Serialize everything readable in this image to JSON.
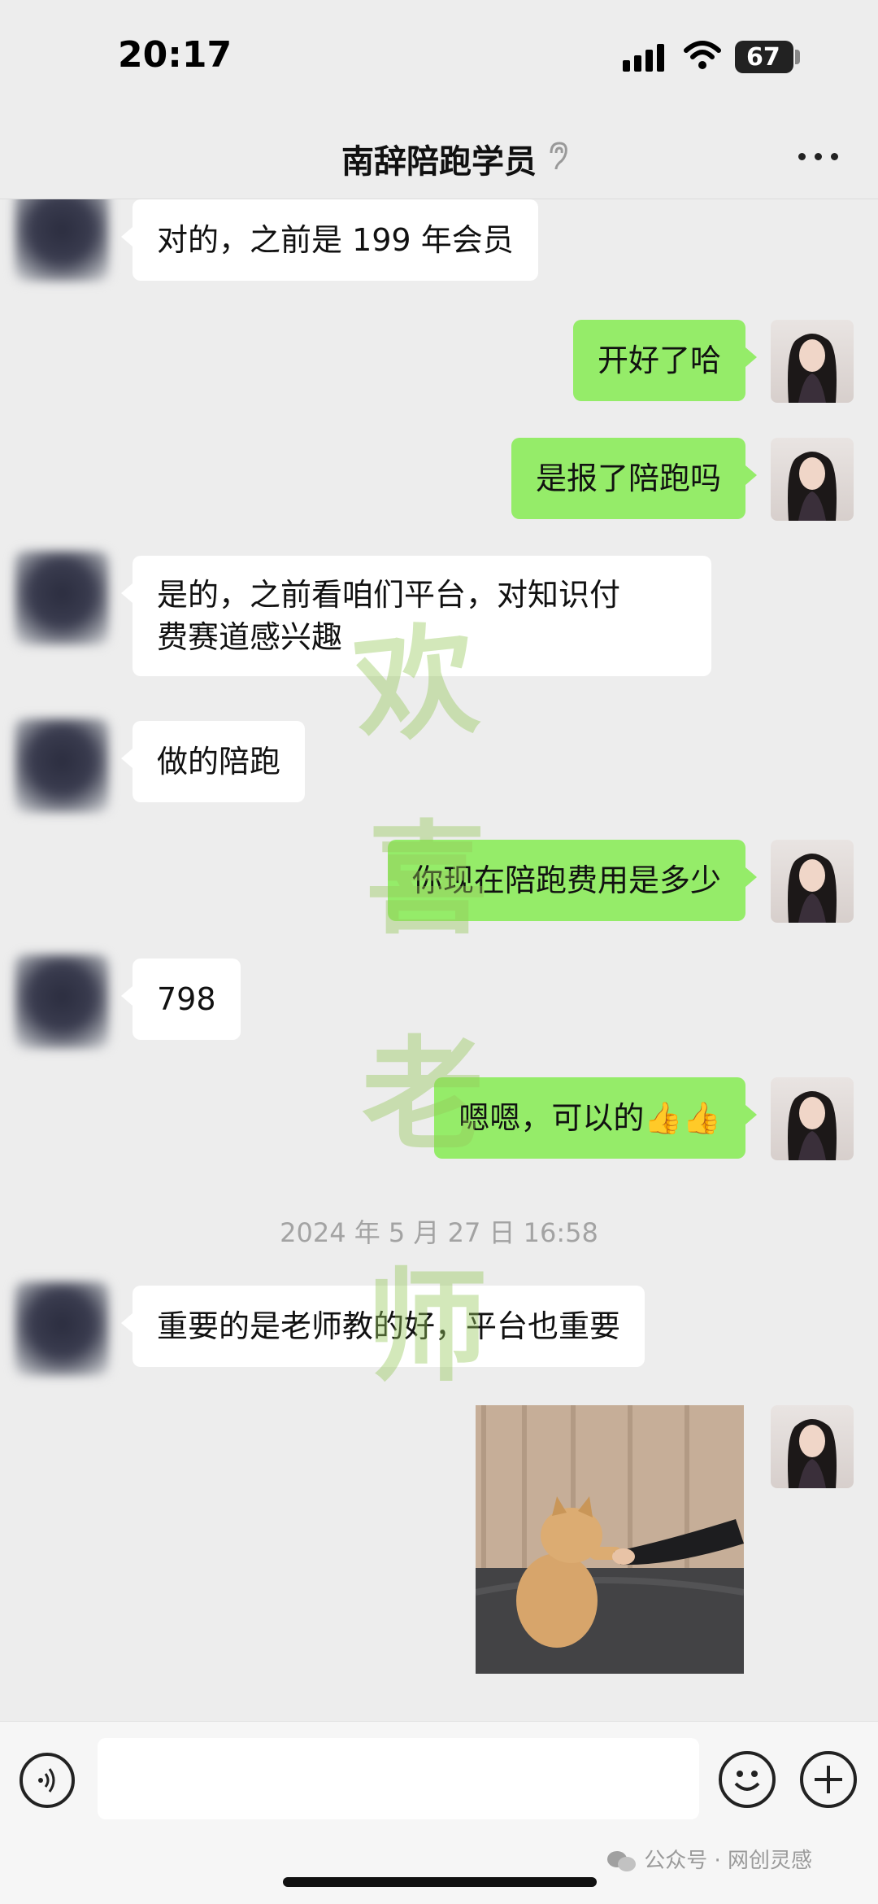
{
  "status_bar": {
    "time": "20:17",
    "battery": "67"
  },
  "header": {
    "title": "南辞陪跑学员"
  },
  "messages": [
    {
      "side": "in",
      "text": "对的，之前是 199 年会员"
    },
    {
      "side": "out",
      "text": "开好了哈"
    },
    {
      "side": "out",
      "text": "是报了陪跑吗"
    },
    {
      "side": "in",
      "line1": "是的，之前看咱们平台，对知识付",
      "line2": "费赛道感兴趣"
    },
    {
      "side": "in",
      "text": "做的陪跑"
    },
    {
      "side": "out",
      "text": "你现在陪跑费用是多少"
    },
    {
      "side": "in",
      "text": "798"
    },
    {
      "side": "out",
      "text": "嗯嗯，可以的👍👍"
    },
    {
      "side": "in",
      "text": "重要的是老师教的好，平台也重要"
    },
    {
      "side": "out",
      "type": "image"
    }
  ],
  "timestamp": "2024 年 5 月 27 日 16:58",
  "watermark": {
    "chars": [
      "欢",
      "喜",
      "老",
      "师"
    ]
  },
  "source": "公众号 · 网创灵感",
  "icons": [
    "ear-icon",
    "more-icon",
    "voice-icon",
    "emoji-icon",
    "plus-icon",
    "wechat-icon"
  ]
}
